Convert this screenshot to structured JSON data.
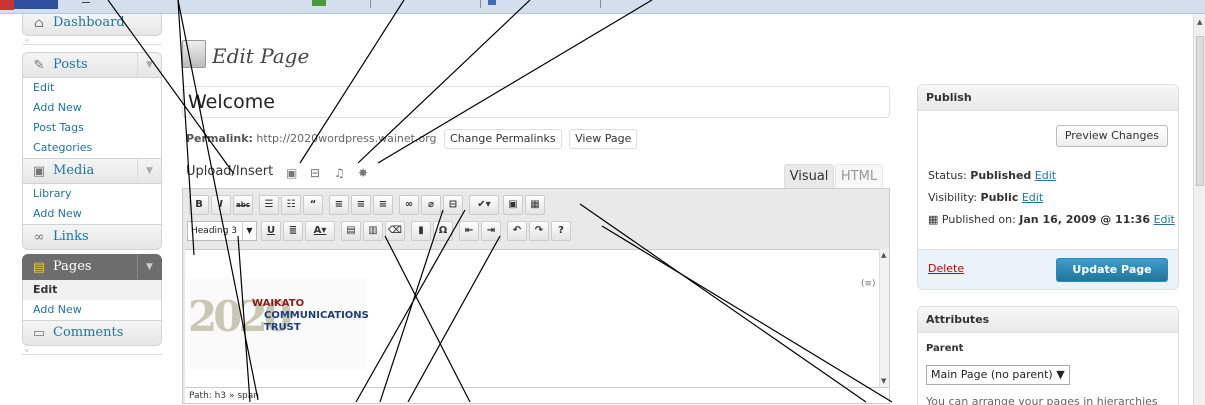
{
  "sidebar": {
    "dashboard": "Dashboard",
    "posts": {
      "label": "Posts",
      "items": [
        "Edit",
        "Add New",
        "Post Tags",
        "Categories"
      ]
    },
    "media": {
      "label": "Media",
      "items": [
        "Library",
        "Add New"
      ]
    },
    "links": "Links",
    "pages": {
      "label": "Pages",
      "items": [
        "Edit",
        "Add New"
      ]
    },
    "comments": "Comments"
  },
  "main": {
    "heading": "Edit Page",
    "title_value": "Welcome",
    "permalink_label": "Permalink:",
    "permalink_url": "http://2020wordpress.wainet.org",
    "change_permalinks": "Change Permalinks",
    "view_page": "View Page",
    "upload_insert": "Upload/Insert",
    "tabs": {
      "visual": "Visual",
      "html": "HTML"
    },
    "format_select": "Heading 3",
    "path": "Path: h3 » span"
  },
  "logo": {
    "digits": "2020",
    "line1": "WAIKATO",
    "line2": "COMMUNICATIONS",
    "line3": "TRUST"
  },
  "publish": {
    "title": "Publish",
    "preview": "Preview Changes",
    "status_label": "Status:",
    "status_value": "Published",
    "visibility_label": "Visibility:",
    "visibility_value": "Public",
    "published_label": "Published on:",
    "published_value": "Jan 16, 2009 @ 11:36",
    "edit": "Edit",
    "delete": "Delete",
    "update": "Update Page"
  },
  "attributes": {
    "title": "Attributes",
    "parent_label": "Parent",
    "parent_value": "Main Page (no parent)",
    "help": "You can arrange your pages in hierarchies"
  },
  "colors": {
    "link": "#21759b",
    "update_button": "#21759b",
    "delete": "#cc0000",
    "menu_active": "#6d6d6d"
  }
}
